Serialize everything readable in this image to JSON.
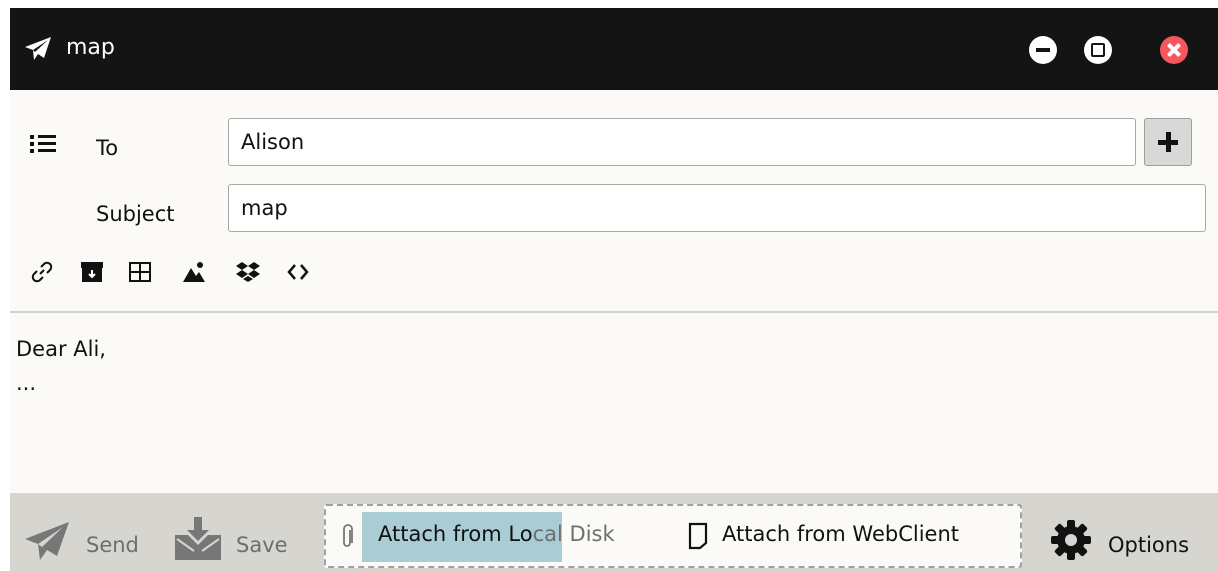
{
  "window": {
    "title": "map"
  },
  "compose": {
    "to_label": "To",
    "to_value": "Alison",
    "subject_label": "Subject",
    "subject_value": "map"
  },
  "toolbar": {
    "icons": [
      "link-icon",
      "archive-icon",
      "table-icon",
      "image-icon",
      "dropbox-icon",
      "code-icon"
    ]
  },
  "body": {
    "lines": [
      "Dear Ali,",
      "..."
    ]
  },
  "footer": {
    "send_label": "Send",
    "save_label": "Save",
    "attach_local_highlighted": "Attach from Lo",
    "attach_local_rest": "cal Disk",
    "attach_web_label": "Attach from WebClient",
    "options_label": "Options"
  },
  "colors": {
    "titlebar": "#141414",
    "close": "#f6575c",
    "highlight": "#a9ccd5",
    "footer": "#d6d5d0"
  }
}
